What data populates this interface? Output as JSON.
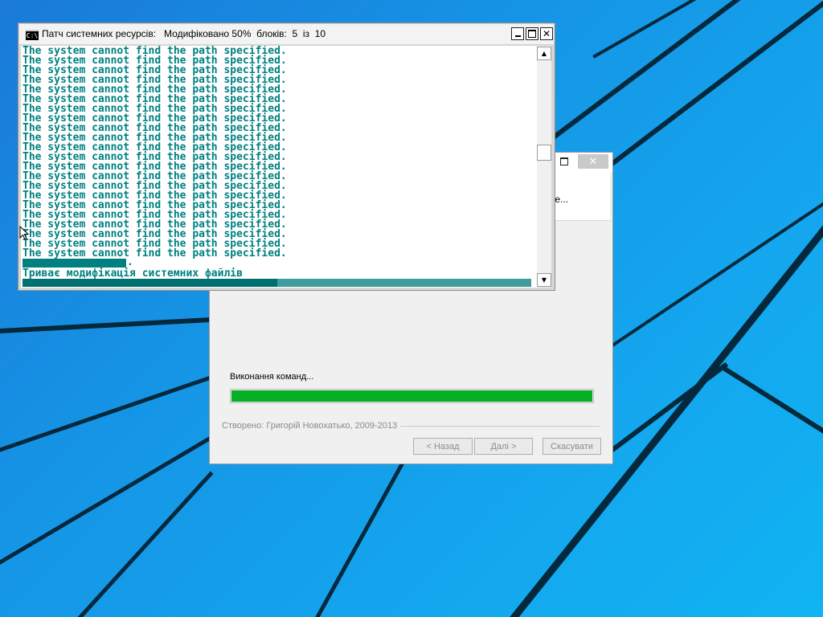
{
  "console": {
    "icon_label": "C:\\",
    "title": "Патч системних ресурсів:   Модифіковано 50%  блоків:  5  із  10",
    "lines": [
      "The system cannot find the path specified.",
      "The system cannot find the path specified.",
      "The system cannot find the path specified.",
      "The system cannot find the path specified.",
      "The system cannot find the path specified.",
      "The system cannot find the path specified.",
      "The system cannot find the path specified.",
      "The system cannot find the path specified.",
      "The system cannot find the path specified.",
      "The system cannot find the path specified.",
      "The system cannot find the path specified.",
      "The system cannot find the path specified.",
      "The system cannot find the path specified.",
      "The system cannot find the path specified.",
      "The system cannot find the path specified.",
      "The system cannot find the path specified.",
      "The system cannot find the path specified.",
      "The system cannot find the path specified.",
      "The system cannot find the path specified.",
      "The system cannot find the path specified.",
      "The system cannot find the path specified.",
      "The system cannot find the path specified."
    ],
    "trailing_dot": ".",
    "status_line": "Триває модифікація системних файлів",
    "progress_fraction": 0.5,
    "text_color": "#008080",
    "buttons": {
      "close": "✕"
    }
  },
  "installer": {
    "header_fragment": "те...",
    "status_label": "Виконання команд...",
    "progress_fraction": 1.0,
    "progress_color": "#06b025",
    "credit": "Створено: Григорій Новохатько, 2009-2013",
    "buttons": {
      "back": "< Назад",
      "next": "Далі >",
      "cancel": "Скасувати",
      "close": "✕"
    }
  },
  "desktop": {
    "background_color": "#1596e6",
    "line_color": "#04283c"
  }
}
